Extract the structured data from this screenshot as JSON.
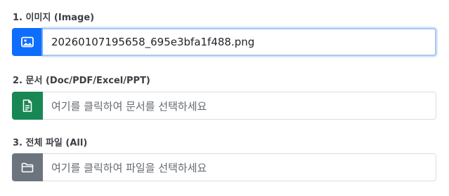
{
  "sections": [
    {
      "label": "1. 이미지 (Image)",
      "value": "20260107195658_695e3bfa1f488.png",
      "icon": "image-icon",
      "color": "#0d6efd"
    },
    {
      "label": "2. 문서 (Doc/PDF/Excel/PPT)",
      "value": "여기를 클릭하여 문서를 선택하세요",
      "icon": "document-icon",
      "color": "#198754"
    },
    {
      "label": "3. 전체 파일 (All)",
      "value": "여기를 클릭하여 파일을 선택하세요",
      "icon": "folder-icon",
      "color": "#6c757d"
    }
  ]
}
